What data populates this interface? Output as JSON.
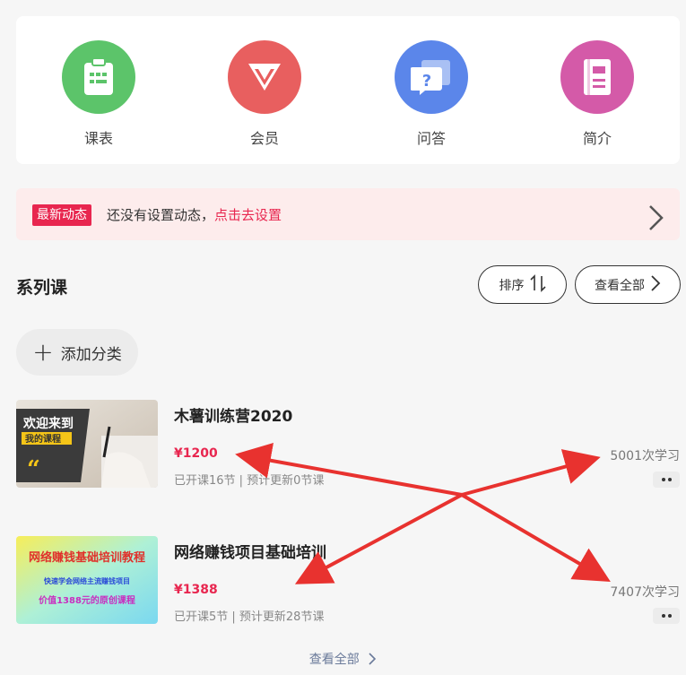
{
  "nav": [
    {
      "label": "课表",
      "icon": "clipboard-icon",
      "color": "#5cc46a"
    },
    {
      "label": "会员",
      "icon": "vip-gem-icon",
      "color": "#e85f5f"
    },
    {
      "label": "问答",
      "icon": "question-chat-icon",
      "color": "#5b86ea"
    },
    {
      "label": "简介",
      "icon": "book-icon",
      "color": "#d45aa8"
    }
  ],
  "news": {
    "badge": "最新动态",
    "text": "还没有设置动态，",
    "link": "点击去设置"
  },
  "series": {
    "title": "系列课",
    "sort_label": "排序",
    "view_all_label": "查看全部"
  },
  "add_category": "添加分类",
  "courses": [
    {
      "title": "木薯训练营2020",
      "price": "¥1200",
      "meta": "已开课16节 | 预计更新0节课",
      "study": "5001次学习",
      "thumb": {
        "line1": "欢迎来到",
        "line2": "我的课程"
      }
    },
    {
      "title": "网络赚钱项目基础培训",
      "price": "¥1388",
      "meta": "已开课5节 | 预计更新28节课",
      "study": "7407次学习",
      "thumb": {
        "line1": "网络赚钱基础培训教程",
        "line2": "快速学会网络主流赚钱项目",
        "line3": "价值1388元的原创课程"
      }
    }
  ],
  "footer": {
    "view_all": "查看全部"
  },
  "colors": {
    "accent": "#e8264f",
    "annotation_arrow": "#e8322f"
  }
}
